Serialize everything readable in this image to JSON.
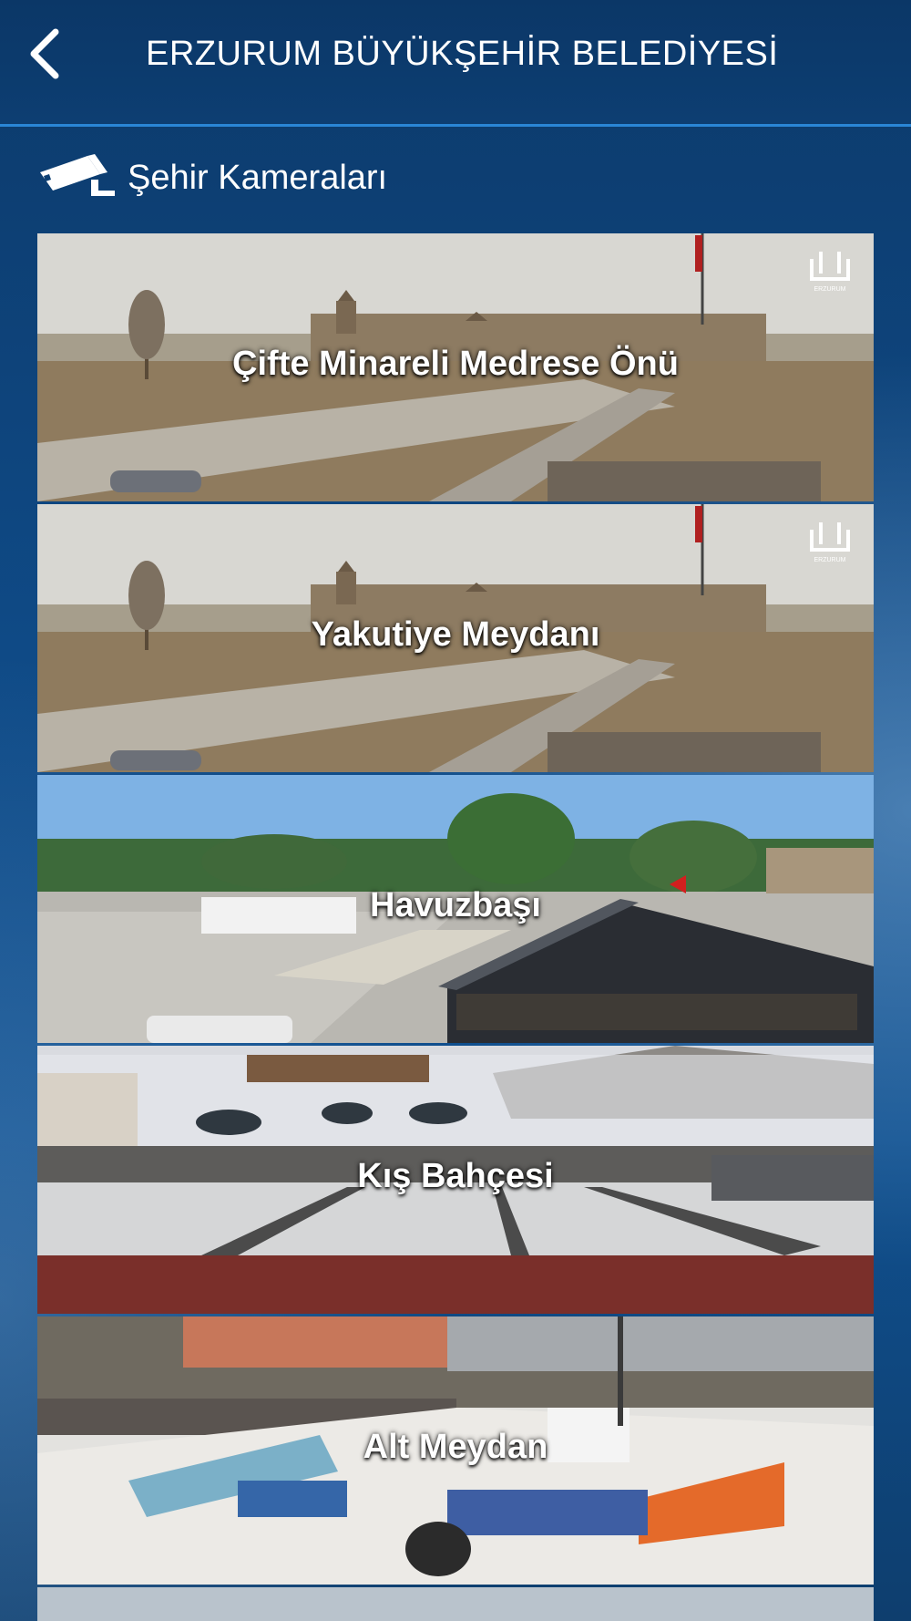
{
  "header": {
    "title": "ERZURUM BÜYÜKŞEHİR BELEDİYESİ",
    "back_icon": "chevron-left-icon"
  },
  "section": {
    "title": "Şehir Kameraları",
    "icon": "security-camera-icon"
  },
  "cameras": [
    {
      "label": "Çifte Minareli Medrese Önü",
      "scene": "castle-square",
      "logo_text": "ERZURUM"
    },
    {
      "label": "Yakutiye Meydanı",
      "scene": "castle-square",
      "logo_text": "ERZURUM"
    },
    {
      "label": "Havuzbaşı",
      "scene": "plaza-summer",
      "logo_text": ""
    },
    {
      "label": "Kış Bahçesi",
      "scene": "snow-resort",
      "logo_text": ""
    },
    {
      "label": "Alt Meydan",
      "scene": "ski-base",
      "logo_text": ""
    }
  ],
  "colors": {
    "header_bg": "#0b3767",
    "header_border": "#2a86d6",
    "text": "#ffffff"
  }
}
